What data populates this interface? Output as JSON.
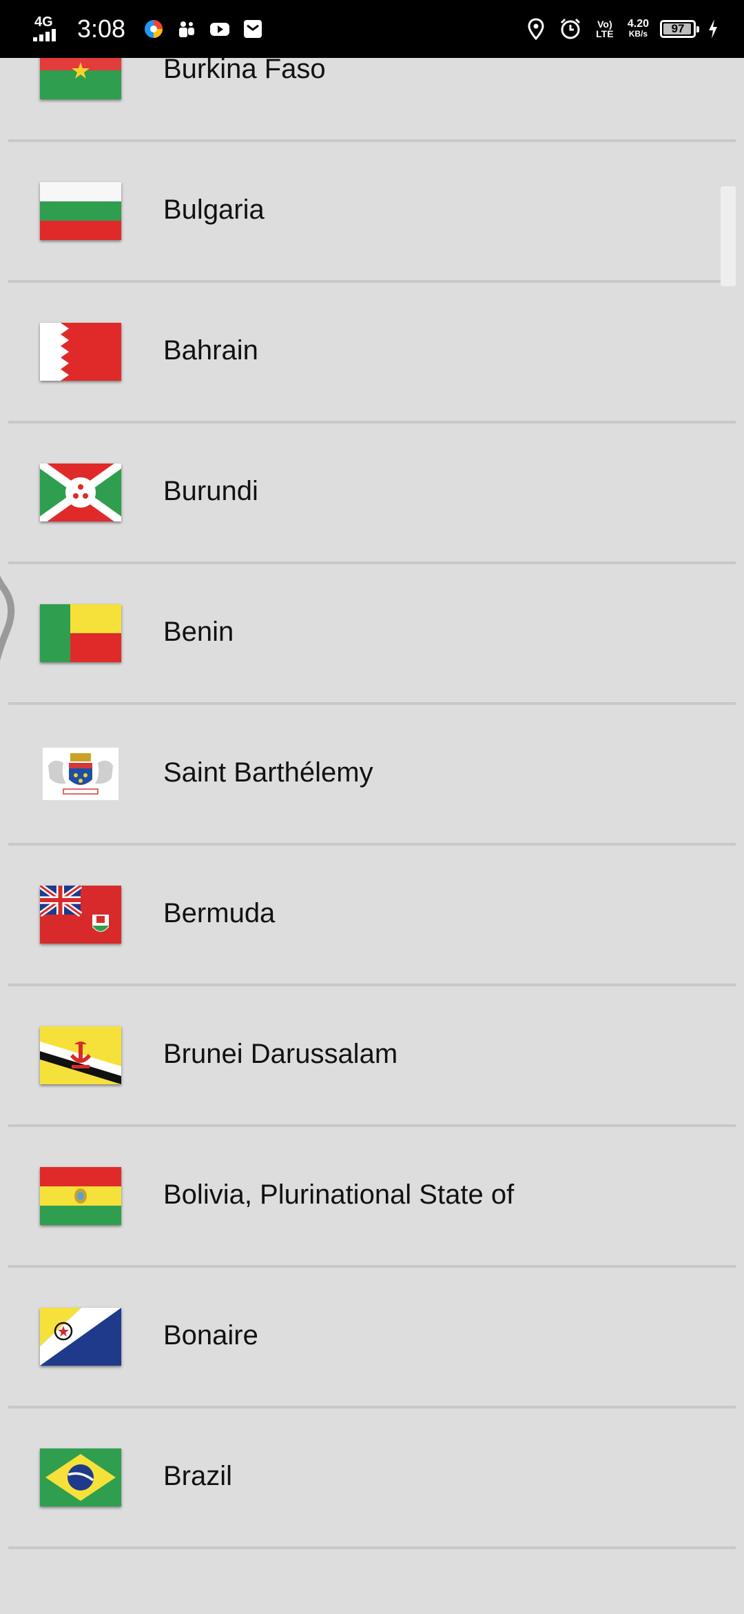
{
  "status_bar": {
    "network": "4G",
    "time": "3:08",
    "volte": "Vo) LTE",
    "speed_value": "4.20",
    "speed_unit": "KB/s",
    "battery": "97",
    "left_icons": [
      "browser-icon",
      "teams-icon",
      "youtube-icon",
      "mail-icon"
    ],
    "right_icons": [
      "location-icon",
      "alarm-icon",
      "volte-icon",
      "speed-indicator",
      "battery-icon",
      "charging-icon"
    ]
  },
  "countries": [
    {
      "name": "Burkina Faso",
      "flag": "burkina-faso-flag"
    },
    {
      "name": "Bulgaria",
      "flag": "bulgaria-flag"
    },
    {
      "name": "Bahrain",
      "flag": "bahrain-flag"
    },
    {
      "name": "Burundi",
      "flag": "burundi-flag"
    },
    {
      "name": "Benin",
      "flag": "benin-flag"
    },
    {
      "name": "Saint Barthélemy",
      "flag": "saint-barthelemy-flag"
    },
    {
      "name": "Bermuda",
      "flag": "bermuda-flag"
    },
    {
      "name": "Brunei Darussalam",
      "flag": "brunei-flag"
    },
    {
      "name": "Bolivia, Plurinational State of",
      "flag": "bolivia-flag"
    },
    {
      "name": "Bonaire",
      "flag": "bonaire-flag"
    },
    {
      "name": "Brazil",
      "flag": "brazil-flag"
    }
  ],
  "colors": {
    "background": "#dddddd",
    "divider": "#c8c8c8",
    "status_bar": "#000000",
    "text": "#111111"
  }
}
